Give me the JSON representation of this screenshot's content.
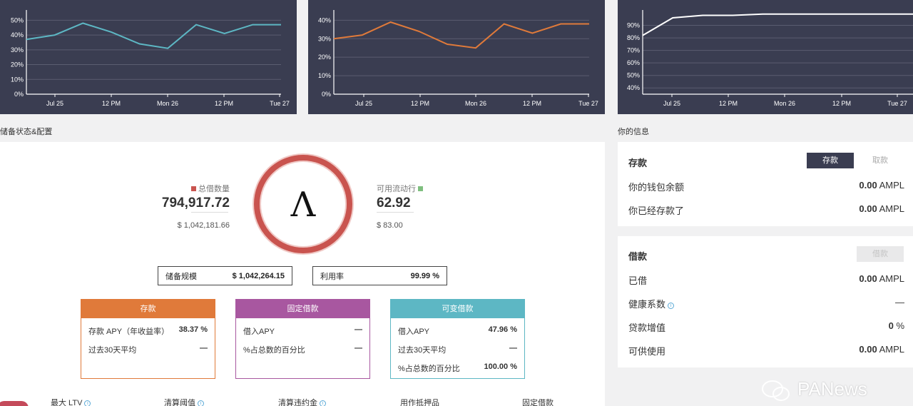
{
  "charts": [
    {
      "type": "line",
      "x_ticks": [
        "Jul 25",
        "12 PM",
        "Mon 26",
        "12 PM",
        "Tue 27"
      ],
      "y_ticks": [
        "0%",
        "10%",
        "20%",
        "30%",
        "40%",
        "50%"
      ],
      "ylim": [
        0,
        55
      ],
      "color": "#5db7c4",
      "series": [
        {
          "values": [
            37,
            40,
            48,
            42,
            34,
            31,
            47,
            41,
            47,
            47
          ]
        }
      ]
    },
    {
      "type": "line",
      "x_ticks": [
        "Jul 25",
        "12 PM",
        "Mon 26",
        "12 PM",
        "Tue 27"
      ],
      "y_ticks": [
        "0%",
        "10%",
        "20%",
        "30%",
        "40%"
      ],
      "ylim": [
        0,
        44
      ],
      "color": "#e07a3a",
      "series": [
        {
          "values": [
            30,
            32,
            39,
            34,
            27,
            25,
            38,
            33,
            38,
            38
          ]
        }
      ]
    },
    {
      "type": "line",
      "x_ticks": [
        "Jul 25",
        "12 PM",
        "Mon 26",
        "12 PM",
        "Tue 27"
      ],
      "y_ticks": [
        "40%",
        "50%",
        "60%",
        "70%",
        "80%",
        "90%"
      ],
      "ylim": [
        35,
        100
      ],
      "color": "#ffffff",
      "series": [
        {
          "values": [
            82,
            96,
            98,
            98,
            99,
            99,
            99,
            99,
            99,
            99
          ]
        }
      ]
    }
  ],
  "reserve": {
    "section_title": "储备状态&配置",
    "total_borrowed_label": "总借数量",
    "total_borrowed_value": "794,917.72",
    "total_borrowed_usd": "$ 1,042,181.66",
    "available_label": "可用流动行",
    "available_value": "62.92",
    "available_usd": "$ 83.00",
    "logo_glyph": "Λ",
    "reserve_size_label": "储备规模",
    "reserve_size_value": "$  1,042,264.15",
    "utilization_label": "利用率",
    "utilization_value": "99.99 %",
    "colors": {
      "borrowed": "#c9544f",
      "available": "#7fbf7f",
      "ring": "#c9544f"
    }
  },
  "cards": {
    "deposit": {
      "title": "存款",
      "color": "#e07a3a",
      "rows": [
        {
          "label": "存款 APY（年收益率）",
          "value": "38.37 %"
        },
        {
          "label": "过去30天平均",
          "value": "—"
        }
      ]
    },
    "stable": {
      "title": "固定借款",
      "color": "#a857a0",
      "rows": [
        {
          "label": "借入APY",
          "value": "—"
        },
        {
          "label": "%占总数的百分比",
          "value": "—"
        }
      ]
    },
    "variable": {
      "title": "可变借款",
      "color": "#5db7c4",
      "rows": [
        {
          "label": "借入APY",
          "value": "47.96 %"
        },
        {
          "label": "过去30天平均",
          "value": "—"
        },
        {
          "label": "%占总数的百分比",
          "value": "100.00 %"
        }
      ]
    }
  },
  "bottom_labels": {
    "ltv": "最大 LTV",
    "threshold": "清算阈值",
    "penalty": "清算违约金",
    "collateral": "用作抵押品",
    "stable_borrow": "固定借款"
  },
  "info": {
    "section_title": "你的信息",
    "deposit_card": {
      "title": "存款",
      "deposit_button": "存款",
      "withdraw_button": "取款",
      "rows": [
        {
          "label": "你的钱包余额",
          "value": "0.00",
          "unit": "AMPL"
        },
        {
          "label": "你已经存款了",
          "value": "0.00",
          "unit": "AMPL"
        }
      ]
    },
    "borrow_card": {
      "title": "借款",
      "borrow_button": "借款",
      "borrowed_label": "已借",
      "borrowed_value": "0.00",
      "borrowed_unit": "AMPL",
      "health_label": "健康系数",
      "health_value": "—",
      "ltv_label": "贷款增值",
      "ltv_value": "0",
      "ltv_unit": "%",
      "available_label": "可供使用",
      "available_value": "0.00",
      "available_unit": "AMPL"
    }
  },
  "watermark": "PANews"
}
